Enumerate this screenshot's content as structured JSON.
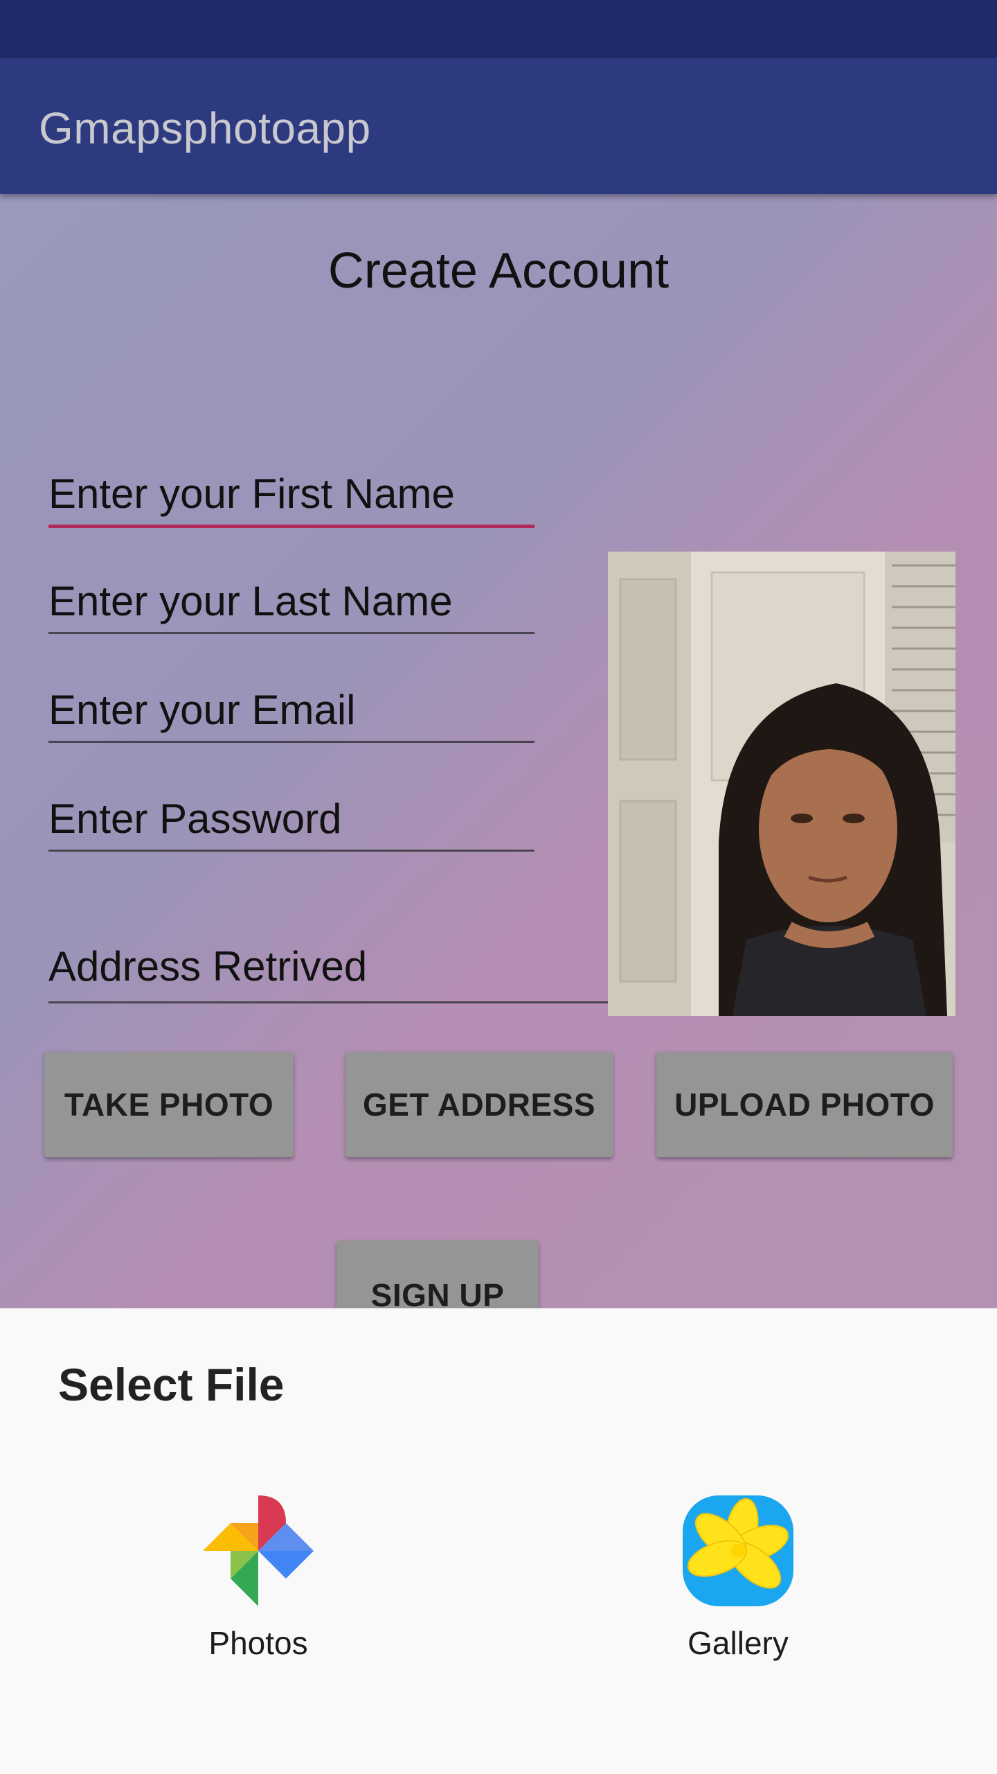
{
  "app_bar": {
    "title": "Gmapsphotoapp"
  },
  "form": {
    "heading": "Create Account",
    "first_name_placeholder": "Enter your First Name",
    "last_name_placeholder": "Enter your Last Name",
    "email_placeholder": "Enter your Email",
    "password_placeholder": "Enter Password",
    "address_text": "Address Retrived"
  },
  "buttons": {
    "take_photo": "TAKE PHOTO",
    "get_address": "GET ADDRESS",
    "upload_photo": "UPLOAD PHOTO",
    "sign_up": "SIGN UP"
  },
  "sheet": {
    "title": "Select File",
    "options": [
      {
        "label": "Photos",
        "icon": "google-photos-icon"
      },
      {
        "label": "Gallery",
        "icon": "gallery-icon"
      }
    ]
  },
  "colors": {
    "status_bar": "#212a6b",
    "app_bar": "#2d3a7f",
    "accent_underline": "#b22a5c",
    "button": "#959595"
  }
}
